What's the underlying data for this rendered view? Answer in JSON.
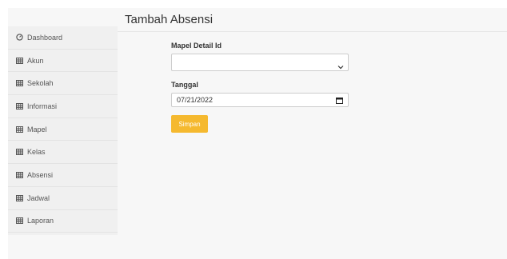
{
  "header": {
    "title": "Tambah Absensi"
  },
  "sidebar": {
    "items": [
      {
        "label": "Dashboard",
        "icon": "dashboard-icon"
      },
      {
        "label": "Akun",
        "icon": "table-icon"
      },
      {
        "label": "Sekolah",
        "icon": "table-icon"
      },
      {
        "label": "Informasi",
        "icon": "table-icon"
      },
      {
        "label": "Mapel",
        "icon": "table-icon"
      },
      {
        "label": "Kelas",
        "icon": "table-icon"
      },
      {
        "label": "Absensi",
        "icon": "table-icon"
      },
      {
        "label": "Jadwal",
        "icon": "table-icon"
      },
      {
        "label": "Laporan",
        "icon": "table-icon"
      }
    ]
  },
  "form": {
    "mapel_label": "Mapel Detail Id",
    "mapel_value": "",
    "tanggal_label": "Tanggal",
    "tanggal_value": "07/21/2022",
    "submit_label": "Simpan"
  },
  "colors": {
    "accent": "#f5b92f",
    "sidebar_bg": "#f0f0f0",
    "content_bg": "#f7f7f7"
  }
}
